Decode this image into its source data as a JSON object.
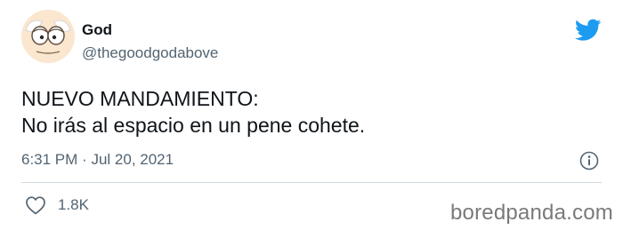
{
  "author": {
    "display_name": "God",
    "handle": "@thegoodgodabove"
  },
  "tweet": {
    "lines": [
      "NUEVO MANDAMIENTO:",
      "No irás al espacio en un pene cohete."
    ],
    "time": "6:31 PM",
    "separator": "·",
    "date": "Jul 20, 2021"
  },
  "engagement": {
    "like_count": "1.8K"
  },
  "icons": {
    "brand": "twitter-bird-icon",
    "info": "info-icon",
    "like": "heart-icon"
  },
  "watermark": "boredpanda.com",
  "colors": {
    "twitter_blue": "#1d9bf0",
    "secondary_text": "#536471",
    "divider": "#cfd9de"
  }
}
